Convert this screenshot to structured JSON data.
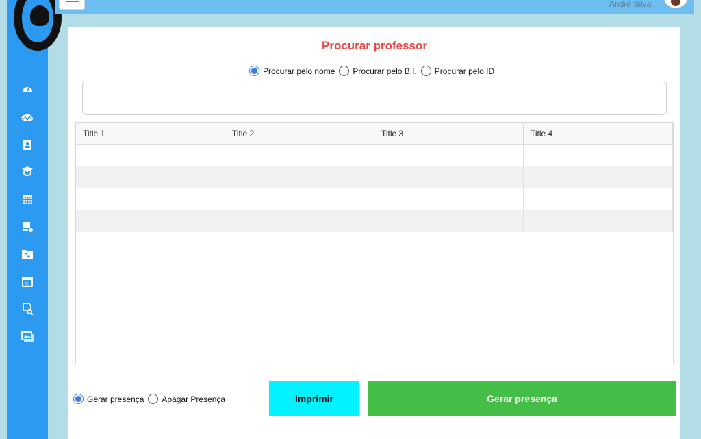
{
  "header": {
    "user_name": "André Silva"
  },
  "sidebar": {
    "items": [
      {
        "icon": "dashboard-gauge-icon"
      },
      {
        "icon": "cloud-chart-icon"
      },
      {
        "icon": "clipboard-user-icon"
      },
      {
        "icon": "graduation-cap-icon"
      },
      {
        "icon": "calculator-icon"
      },
      {
        "icon": "server-settings-icon"
      },
      {
        "icon": "phone-folder-icon"
      },
      {
        "icon": "calendar-icon"
      },
      {
        "icon": "document-search-icon"
      },
      {
        "icon": "gallery-icon"
      }
    ]
  },
  "main": {
    "title": "Procurar professor",
    "search_options": [
      "Procurar pelo nome",
      "Procurar pelo B.I.",
      "Procurar pelo ID"
    ],
    "selected_search_option": "Procurar pelo nome",
    "search_value": "",
    "table": {
      "columns": [
        "Title 1",
        "Title 2",
        "Title 3",
        "Title 4"
      ],
      "rows": [
        [
          "",
          "",
          "",
          ""
        ],
        [
          "",
          "",
          "",
          ""
        ],
        [
          "",
          "",
          "",
          ""
        ],
        [
          "",
          "",
          "",
          ""
        ]
      ]
    },
    "presence_options": [
      "Gerar presença",
      "Apagar Presença"
    ],
    "selected_presence_option": "Gerar presença",
    "print_label": "Imprimir",
    "generate_label": "Gerar presença"
  },
  "colors": {
    "sidebar": "#2b9af0",
    "topbar": "#6cbdf0",
    "background": "#b2dde6",
    "title": "#e84545",
    "print_button": "#00f3ff",
    "generate_button": "#45be48"
  }
}
